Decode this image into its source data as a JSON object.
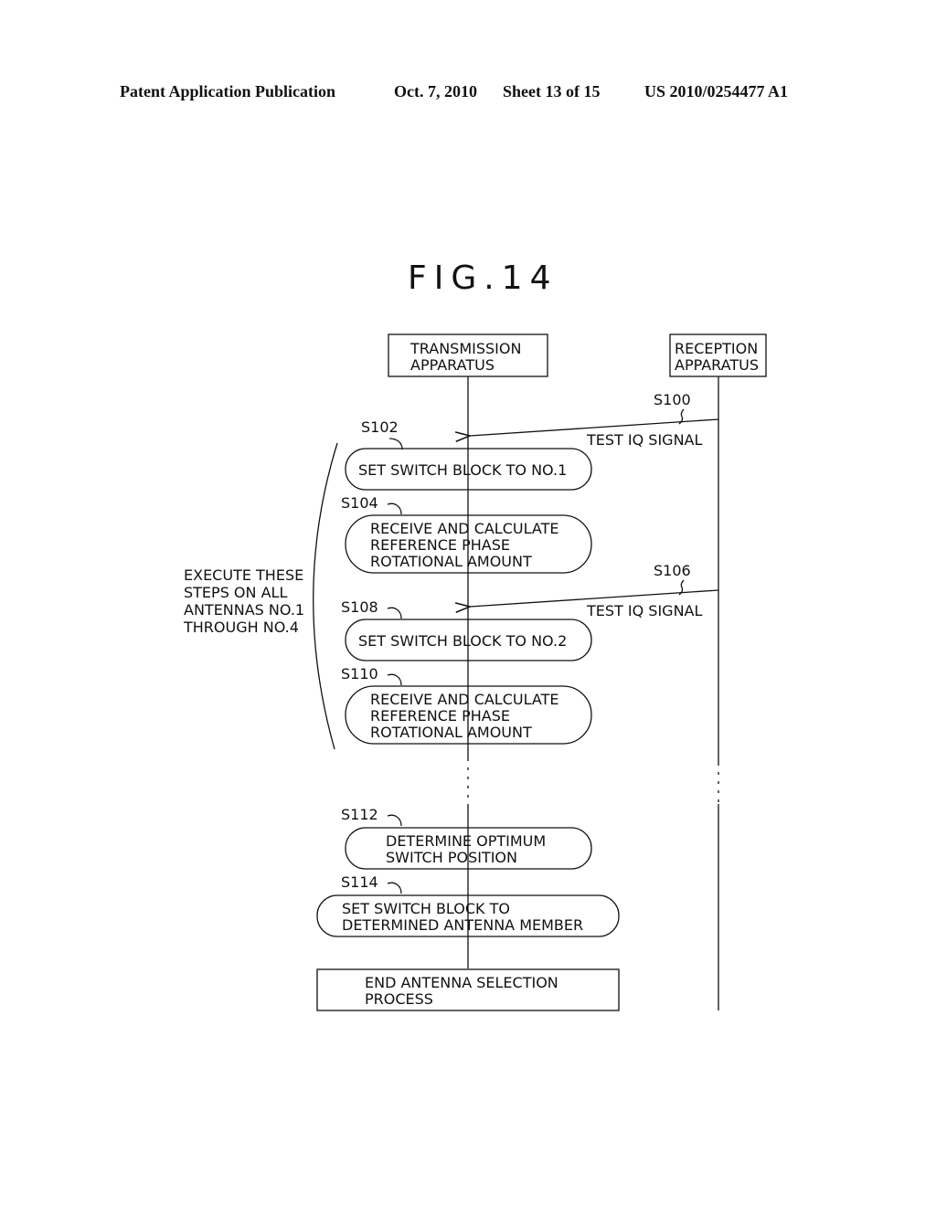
{
  "header": {
    "publication": "Patent Application Publication",
    "date": "Oct. 7, 2010",
    "sheet": "Sheet 13 of 15",
    "number": "US 2010/0254477 A1"
  },
  "figure": {
    "title": "FIG.14"
  },
  "actors": {
    "transmission": [
      "TRANSMISSION",
      "APPARATUS"
    ],
    "reception": [
      "RECEPTION",
      "APPARATUS"
    ]
  },
  "messages": [
    {
      "step": "S100",
      "label": "TEST IQ SIGNAL"
    },
    {
      "step": "S106",
      "label": "TEST IQ SIGNAL"
    }
  ],
  "steps": [
    {
      "id": "S102",
      "lines": [
        "SET SWITCH BLOCK TO NO.1"
      ]
    },
    {
      "id": "S104",
      "lines": [
        "RECEIVE AND CALCULATE",
        "REFERENCE PHASE",
        "ROTATIONAL AMOUNT"
      ]
    },
    {
      "id": "S108",
      "lines": [
        "SET SWITCH BLOCK TO NO.2"
      ]
    },
    {
      "id": "S110",
      "lines": [
        "RECEIVE AND CALCULATE",
        "REFERENCE PHASE",
        "ROTATIONAL AMOUNT"
      ]
    },
    {
      "id": "S112",
      "lines": [
        "DETERMINE OPTIMUM",
        "SWITCH POSITION"
      ]
    },
    {
      "id": "S114",
      "lines": [
        "SET SWITCH BLOCK TO",
        "DETERMINED ANTENNA MEMBER"
      ]
    }
  ],
  "end": {
    "lines": [
      "END ANTENNA SELECTION",
      "PROCESS"
    ]
  },
  "loop_note": [
    "EXECUTE THESE",
    "STEPS ON ALL",
    "ANTENNAS NO.1",
    "THROUGH NO.4"
  ]
}
